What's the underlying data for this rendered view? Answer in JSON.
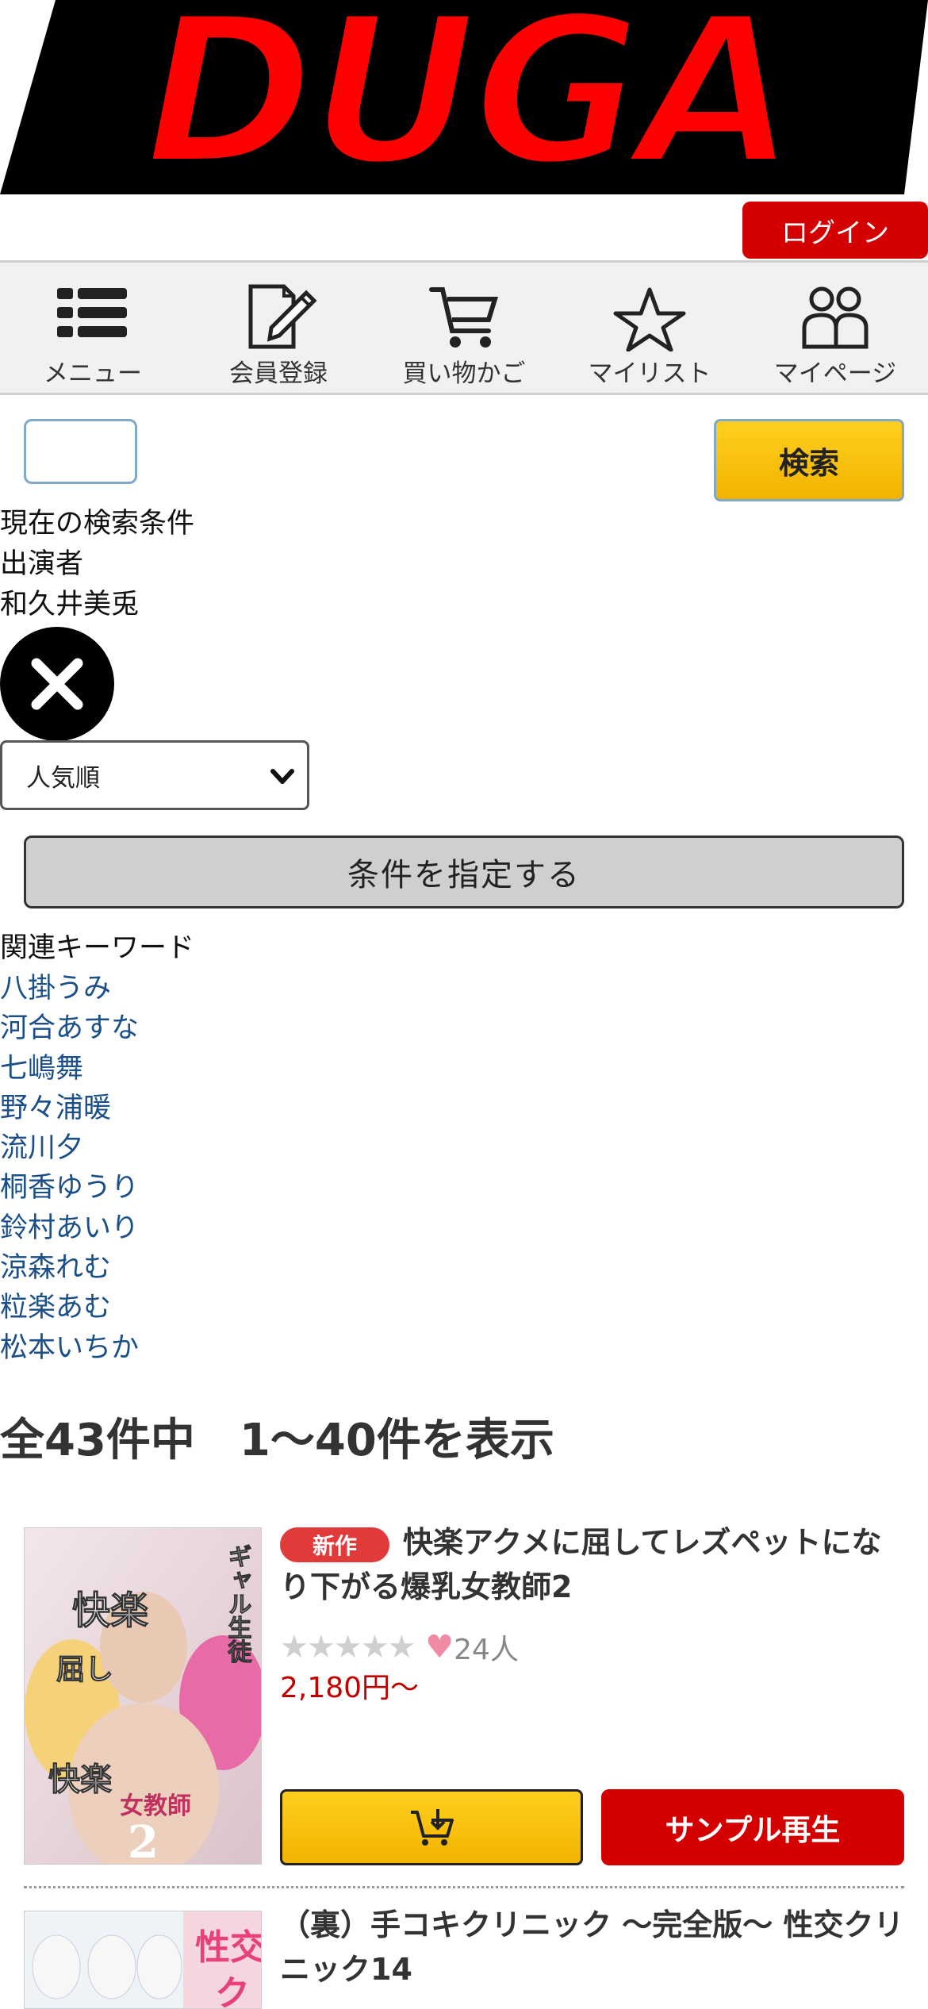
{
  "brand": {
    "logo_text": "DUGA",
    "accent": "#d40000"
  },
  "header": {
    "login_label": "ログイン"
  },
  "nav": {
    "items": [
      {
        "label": "メニュー",
        "icon": "menu-icon"
      },
      {
        "label": "会員登録",
        "icon": "register-icon"
      },
      {
        "label": "買い物かご",
        "icon": "cart-icon"
      },
      {
        "label": "マイリスト",
        "icon": "star-icon"
      },
      {
        "label": "マイページ",
        "icon": "user-icon"
      }
    ]
  },
  "search": {
    "value": "",
    "button_label": "検索"
  },
  "conditions": {
    "heading": "現在の検索条件",
    "type": "出演者",
    "value": "和久井美兎",
    "clear_icon": "close-icon"
  },
  "sort": {
    "selected": "人気順"
  },
  "apply_label": "条件を指定する",
  "keywords": {
    "heading": "関連キーワード",
    "items": [
      "八掛うみ",
      "河合あすな",
      "七嶋舞",
      "野々浦暖",
      "流川夕",
      "桐香ゆうり",
      "鈴村あいり",
      "涼森れむ",
      "粒楽あむ",
      "松本いちか"
    ]
  },
  "results": {
    "summary": "全43件中　1〜40件を表示"
  },
  "products": [
    {
      "badge": "新作",
      "title": "快楽アクメに屈してレズペットになり下がる爆乳女教師2",
      "stars": "★★★★★",
      "likes": "24人",
      "price": "2,180円〜",
      "cart_icon": "cart-download-icon",
      "sample_label": "サンプル再生",
      "cover_text": {
        "a": "ギャル生徒",
        "b": "快楽",
        "c": "屈し",
        "d": "女教師",
        "e": "2"
      }
    },
    {
      "title": "（裏）手コキクリニック 〜完全版〜 性交クリニック14",
      "cover_text": {
        "a": "性交",
        "b": "ク"
      }
    }
  ]
}
